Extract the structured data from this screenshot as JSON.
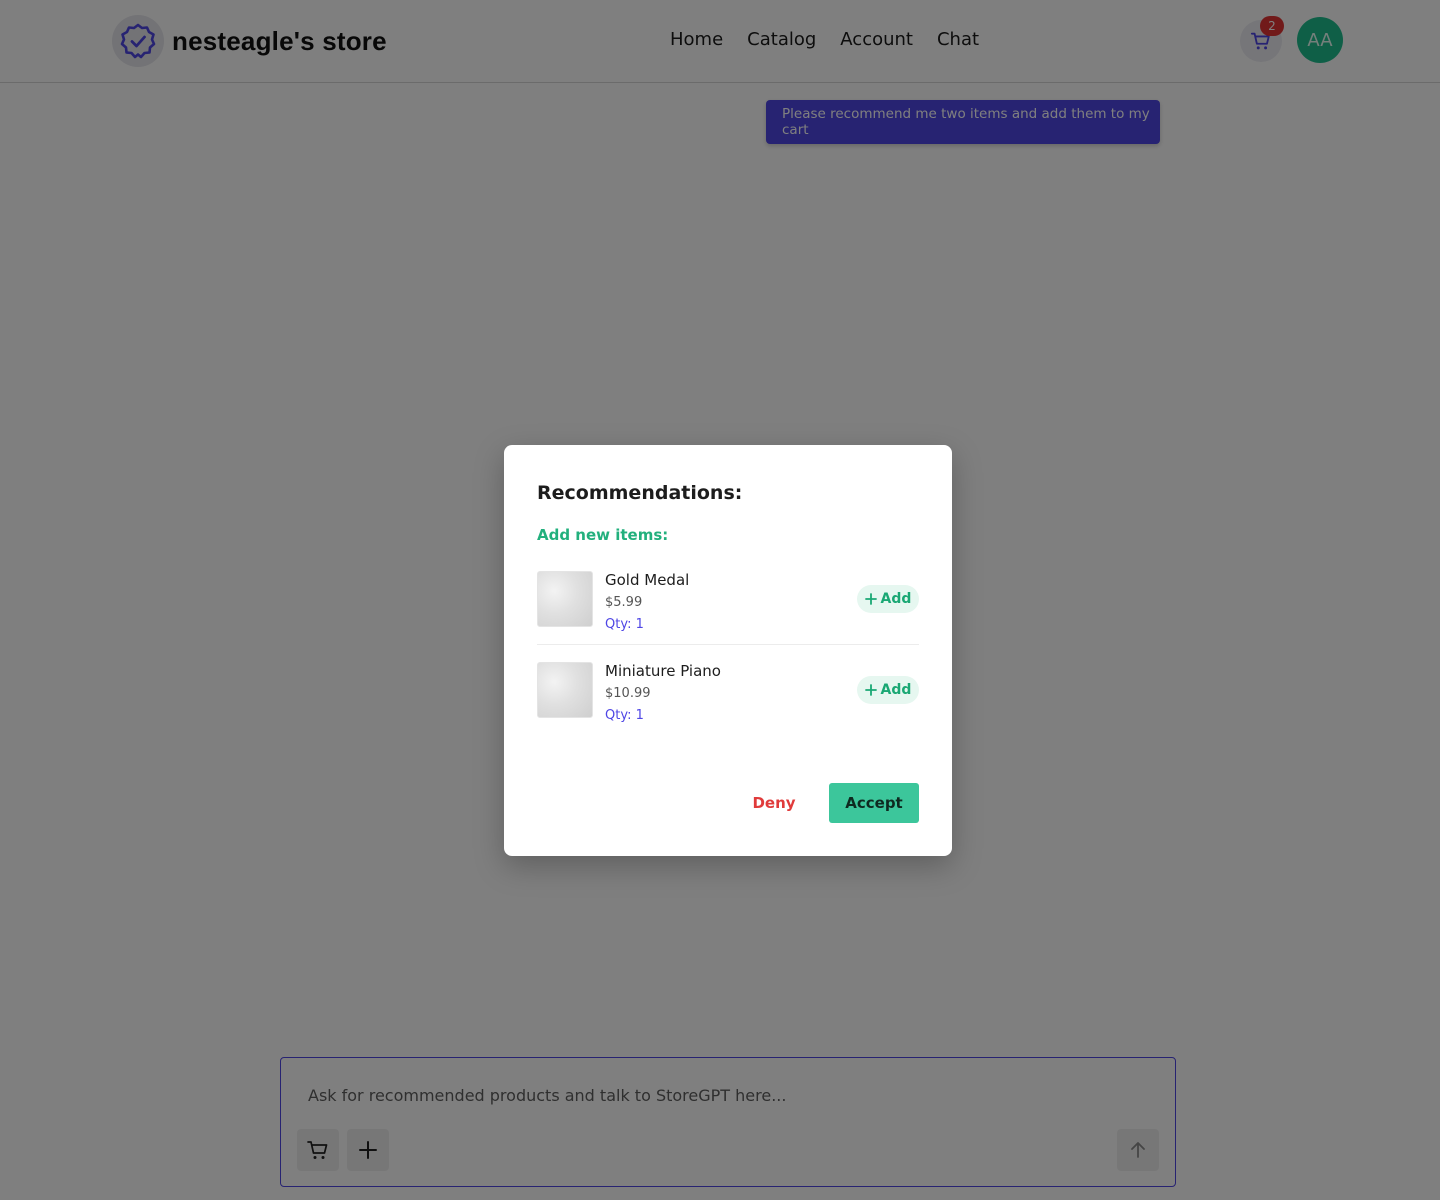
{
  "header": {
    "store_name": "nesteagle's store",
    "logo_icon": "verified-badge-icon",
    "nav": [
      {
        "label": "Home"
      },
      {
        "label": "Catalog"
      },
      {
        "label": "Account"
      },
      {
        "label": "Chat"
      }
    ],
    "cart_count": "2",
    "avatar_initials": "AA"
  },
  "chat": {
    "user_message": "Please recommend me two items and add them to my cart"
  },
  "composer": {
    "placeholder": "Ask for recommended products and talk to StoreGPT here..."
  },
  "modal": {
    "title": "Recommendations:",
    "subtitle": "Add new items:",
    "items": [
      {
        "name": "Gold Medal",
        "price": "$5.99",
        "qty": "Qty: 1",
        "add_label": "Add"
      },
      {
        "name": "Miniature Piano",
        "price": "$10.99",
        "qty": "Qty: 1",
        "add_label": "Add"
      }
    ],
    "deny_label": "Deny",
    "accept_label": "Accept"
  },
  "colors": {
    "accent": "#4f46e5",
    "success": "#3cc69b",
    "danger": "#e03b3b",
    "badge": "#e23434",
    "avatar": "#1fbf8f"
  }
}
